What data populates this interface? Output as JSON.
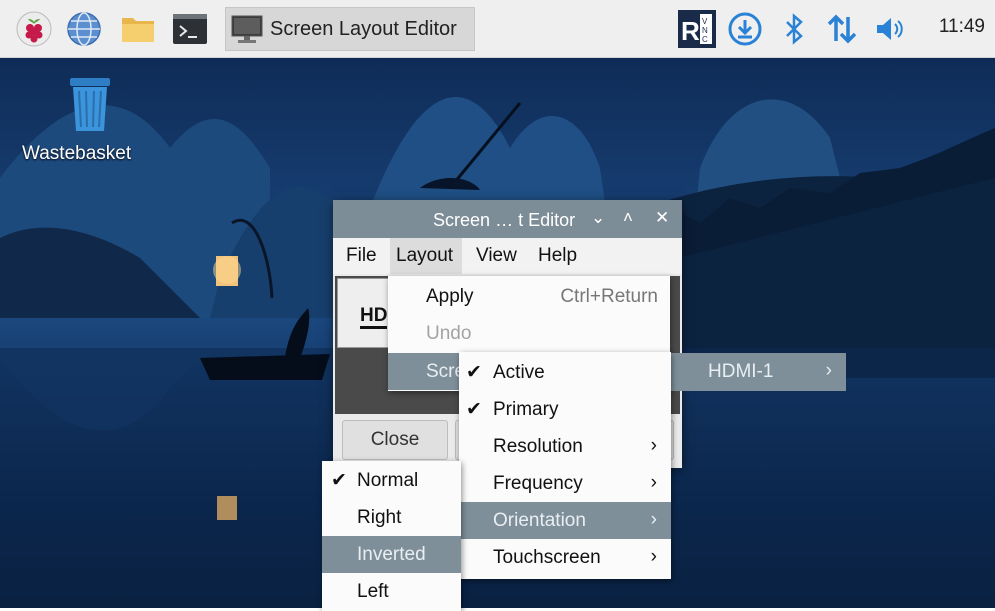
{
  "taskbar": {
    "task_title": "Screen Layout Editor",
    "clock": "11:49",
    "launcher_icons": [
      "raspberry-menu-icon",
      "web-browser-icon",
      "file-manager-icon",
      "terminal-icon"
    ],
    "tray_icons": [
      "vnc-icon",
      "updater-icon",
      "bluetooth-icon",
      "network-icon",
      "volume-icon"
    ]
  },
  "desktop": {
    "wastebasket_label": "Wastebasket"
  },
  "window": {
    "title_left": "Screen",
    "title_ellipsis": "…",
    "title_right": "t Editor",
    "menus": [
      "File",
      "Layout",
      "View",
      "Help"
    ],
    "monitor_label": "HD",
    "close_button": "Close"
  },
  "layout_menu": {
    "apply": "Apply",
    "apply_shortcut": "Ctrl+Return",
    "undo": "Undo",
    "screens": "Scre"
  },
  "screens_submenu": {
    "hdmi": "HDMI-1"
  },
  "hdmi_submenu": {
    "active": "Active",
    "primary": "Primary",
    "resolution": "Resolution",
    "frequency": "Frequency",
    "orientation": "Orientation",
    "touchscreen": "Touchscreen"
  },
  "orientation_submenu": {
    "normal": "Normal",
    "right": "Right",
    "inverted": "Inverted",
    "left": "Left"
  },
  "glyphs": {
    "check": "✔",
    "arrow": "›",
    "minimize": "⌄",
    "maximize": "˄",
    "close": "✕"
  },
  "colors": {
    "menu_highlight": "#7f8f99",
    "title_bar": "#7d8d97",
    "taskbar": "#efefef"
  }
}
